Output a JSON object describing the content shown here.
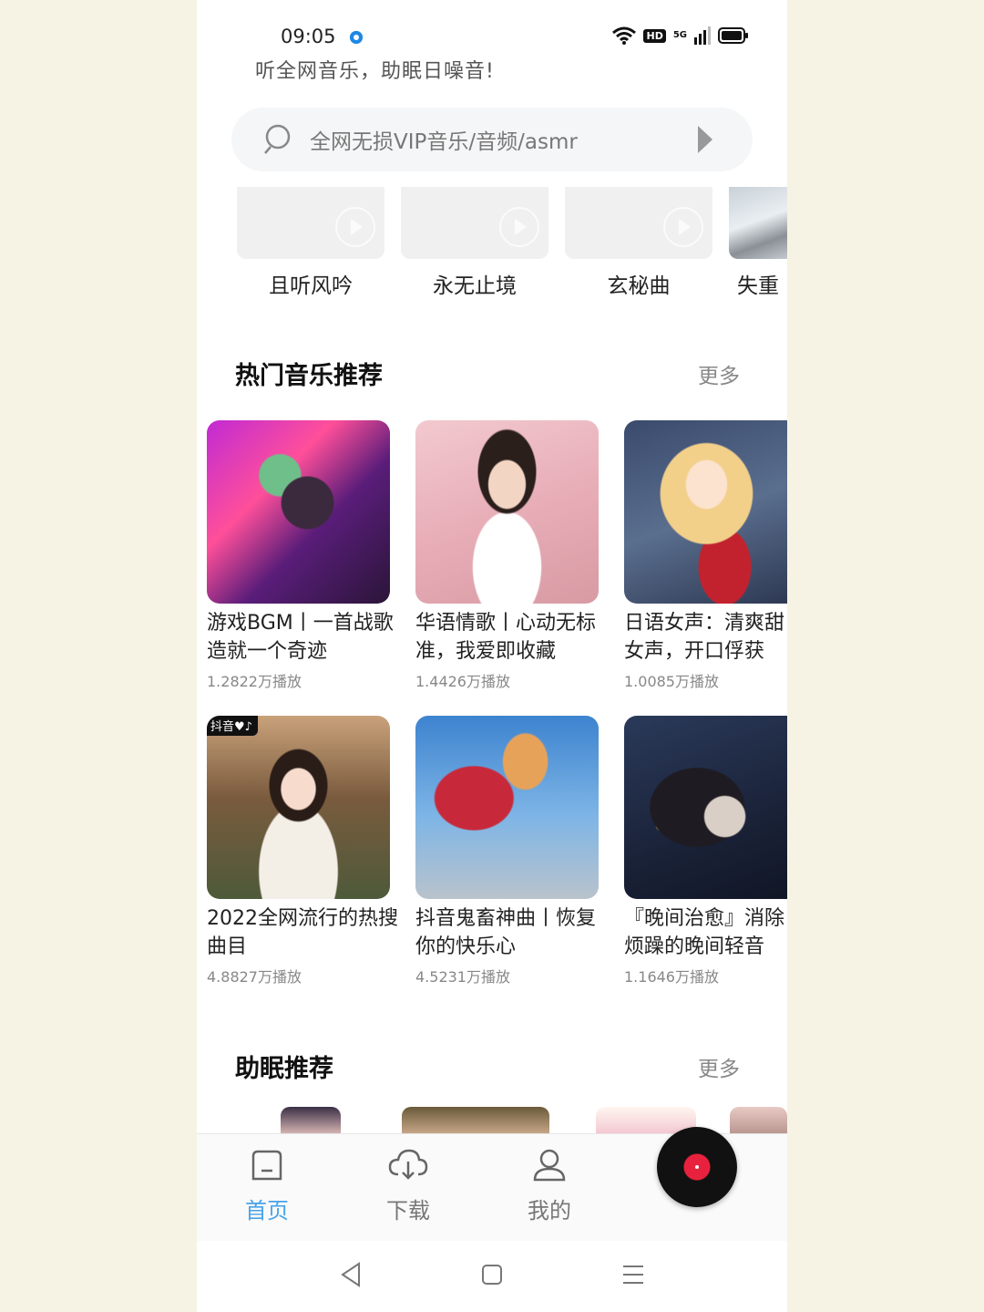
{
  "status_bar": {
    "time": "09:05",
    "hd": "HD",
    "net": "5G"
  },
  "slogan": "听全网音乐，助眠日噪音!",
  "search": {
    "placeholder": "全网无损VIP音乐/音频/asmr"
  },
  "quick_playlists": [
    {
      "label": "且听风吟"
    },
    {
      "label": "永无止境"
    },
    {
      "label": "玄秘曲"
    },
    {
      "label": "失重"
    }
  ],
  "hot_section": {
    "title": "热门音乐推荐",
    "more": "更多",
    "cards": [
      {
        "title": "游戏BGM丨一首战歌造就一个奇迹",
        "plays": "1.2822万播放"
      },
      {
        "title": "华语情歌丨心动无标准，我爱即收藏",
        "plays": "1.4426万播放"
      },
      {
        "title": "日语女声：清爽甜女声，开口俘获",
        "plays": "1.0085万播放"
      },
      {
        "title": "2022全网流行的热搜曲目",
        "plays": "4.8827万播放",
        "tag": "抖音♥♪"
      },
      {
        "title": "抖音鬼畜神曲丨恢复你的快乐心",
        "plays": "4.5231万播放"
      },
      {
        "title": "『晚间治愈』消除烦躁的晚间轻音",
        "plays": "1.1646万播放"
      }
    ]
  },
  "sleep_section": {
    "title": "助眠推荐",
    "more": "更多"
  },
  "bottom_nav": {
    "items": [
      {
        "label": "首页",
        "icon": "home-icon",
        "active": true
      },
      {
        "label": "下载",
        "icon": "cloud-download-icon",
        "active": false
      },
      {
        "label": "我的",
        "icon": "user-icon",
        "active": false
      }
    ],
    "player_icon": "vinyl-disc-icon"
  },
  "colors": {
    "accent": "#4aa3e8",
    "disc_center": "#e8223e"
  }
}
